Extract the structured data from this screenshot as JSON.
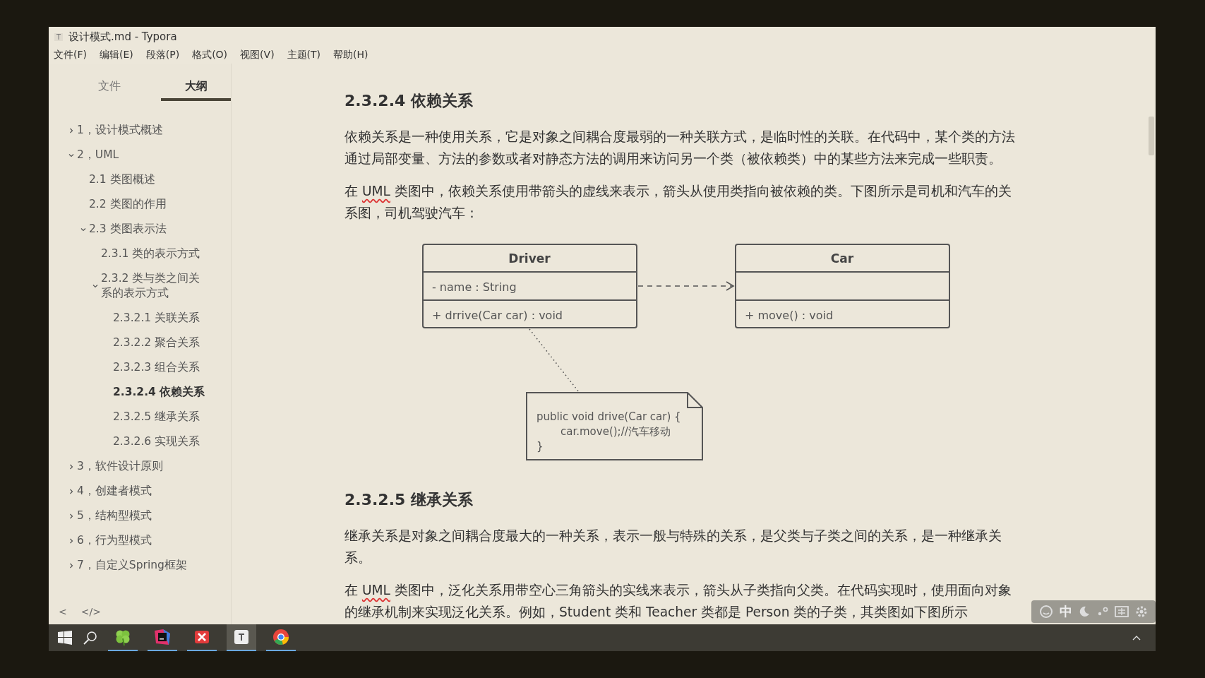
{
  "window": {
    "icon": "T",
    "title": "设计模式.md - Typora"
  },
  "menu": [
    "文件(F)",
    "编辑(E)",
    "段落(P)",
    "格式(O)",
    "视图(V)",
    "主题(T)",
    "帮助(H)"
  ],
  "sidebar": {
    "tabs": [
      {
        "label": "文件",
        "selected": false
      },
      {
        "label": "大纲",
        "selected": true
      }
    ],
    "outline": [
      {
        "label": "1，设计模式概述",
        "expanded": false,
        "selected": false
      },
      {
        "label": "2，UML",
        "expanded": true,
        "selected": false,
        "children": [
          {
            "label": "2.1 类图概述",
            "selected": false
          },
          {
            "label": "2.2 类图的作用",
            "selected": false
          },
          {
            "label": "2.3 类图表示法",
            "expanded": true,
            "selected": false,
            "children": [
              {
                "label": "2.3.1 类的表示方式",
                "selected": false
              },
              {
                "label": "2.3.2 类与类之间关系的表示方式",
                "expanded": true,
                "selected": false,
                "children": [
                  {
                    "label": "2.3.2.1 关联关系",
                    "selected": false
                  },
                  {
                    "label": "2.3.2.2 聚合关系",
                    "selected": false
                  },
                  {
                    "label": "2.3.2.3 组合关系",
                    "selected": false
                  },
                  {
                    "label": "2.3.2.4 依赖关系",
                    "selected": true
                  },
                  {
                    "label": "2.3.2.5 继承关系",
                    "selected": false
                  },
                  {
                    "label": "2.3.2.6 实现关系",
                    "selected": false
                  }
                ]
              }
            ]
          }
        ]
      },
      {
        "label": "3，软件设计原则",
        "expanded": false,
        "selected": false
      },
      {
        "label": "4，创建者模式",
        "expanded": false,
        "selected": false
      },
      {
        "label": "5，结构型模式",
        "expanded": false,
        "selected": false
      },
      {
        "label": "6，行为型模式",
        "expanded": false,
        "selected": false
      },
      {
        "label": "7，自定义Spring框架",
        "expanded": false,
        "selected": false
      }
    ],
    "footer": [
      "<",
      "</>"
    ]
  },
  "document": [
    {
      "kind": "heading",
      "text": "2.3.2.4 依赖关系"
    },
    {
      "kind": "paragraph",
      "parts": [
        {
          "text": "依赖关系是一种使用关系，它是对象之间耦合度最弱的一种关联方式，是临时性的关联。在代码中，某个类的方法通过局部变量、方法的参数或者对静态方法的调用来访问另一个类（被依赖类）中的某些方法来完成一些职责。"
        }
      ]
    },
    {
      "kind": "paragraph",
      "parts": [
        {
          "text": "在 "
        },
        {
          "text": "UML",
          "misspelled": true
        },
        {
          "text": " 类图中，依赖关系使用带箭头的虚线来表示，箭头从使用类指向被依赖的类。下图所示是司机和汽车的关系图，司机驾驶汽车："
        }
      ]
    },
    {
      "kind": "diagram",
      "classes": [
        {
          "name": "Driver",
          "attributes": [
            "- name : String"
          ],
          "methods": [
            "+ drrive(Car car) : void"
          ]
        },
        {
          "name": "Car",
          "methods": [
            "+ move() : void"
          ]
        }
      ],
      "note": [
        "public void drive(Car car) {",
        "car.move();//汽车移动",
        "}"
      ]
    },
    {
      "kind": "heading",
      "text": "2.3.2.5 继承关系"
    },
    {
      "kind": "paragraph",
      "parts": [
        {
          "text": "继承关系是对象之间耦合度最大的一种关系，表示一般与特殊的关系，是父类与子类之间的关系，是一种继承关系。"
        }
      ]
    },
    {
      "kind": "paragraph",
      "parts": [
        {
          "text": "在 "
        },
        {
          "text": "UML",
          "misspelled": true
        },
        {
          "text": " 类图中，泛化关系用带空心三角箭头的实线来表示，箭头从子类指向父类。在代码实现时，使用面向对象的继承机制来实现泛化关系。例如，Student 类和 Teacher 类都是 Person 类的子类，其类图如下图所示"
        }
      ]
    }
  ],
  "ime_toolbar": {
    "label": "中"
  },
  "taskbar": {
    "apps": [
      {
        "kind": "clover",
        "selected": false
      },
      {
        "kind": "ide",
        "selected": false
      },
      {
        "kind": "xmind",
        "selected": false
      },
      {
        "kind": "typora",
        "selected": true
      },
      {
        "kind": "chrome",
        "selected": false
      }
    ]
  }
}
